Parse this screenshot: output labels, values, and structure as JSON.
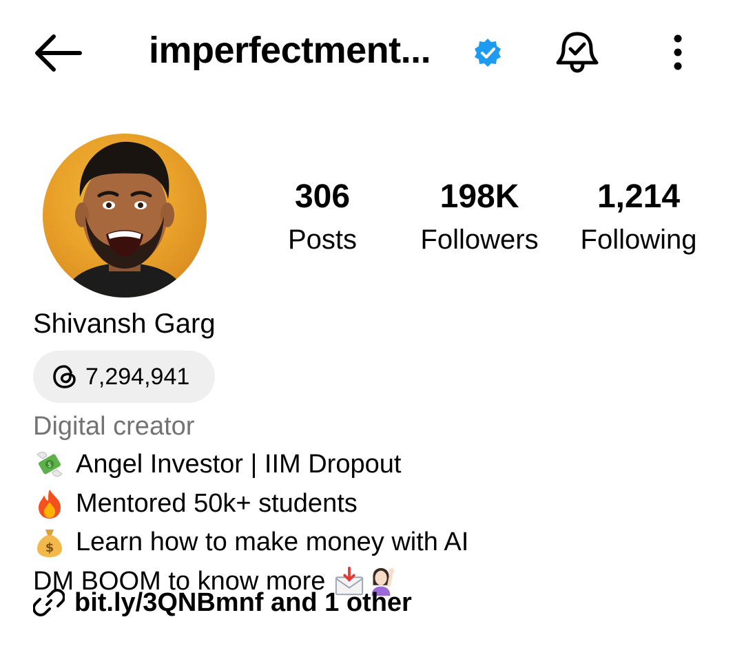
{
  "header": {
    "username": "imperfectment...",
    "back_icon": "arrow-left-icon",
    "verified_icon": "verified-badge-icon",
    "verified_color": "#1d9bf0",
    "notification_icon": "bell-check-icon",
    "more_icon": "more-vertical-icon"
  },
  "profile": {
    "avatar": "avatar",
    "stats": [
      {
        "value": "306",
        "label": "Posts"
      },
      {
        "value": "198K",
        "label": "Followers"
      },
      {
        "value": "1,214",
        "label": "Following"
      }
    ],
    "name": "Shivansh Garg",
    "threads_icon": "threads-icon",
    "threads_count": "7,294,941",
    "category": "Digital creator",
    "bio": [
      {
        "emoji": "money-with-wings-emoji",
        "text": "Angel Investor | IIM Dropout"
      },
      {
        "emoji": "fire-emoji",
        "text": "Mentored 50k+ students"
      },
      {
        "emoji": "money-bag-emoji",
        "text": "Learn how to make money with AI"
      },
      {
        "text": "DM BOOM to know more",
        "trailing_emojis": [
          "envelope-with-arrow-emoji",
          "person-raising-hand-emoji"
        ]
      }
    ],
    "link_icon": "link-icon",
    "link_text": "bit.ly/3QNBmnf and 1 other"
  }
}
